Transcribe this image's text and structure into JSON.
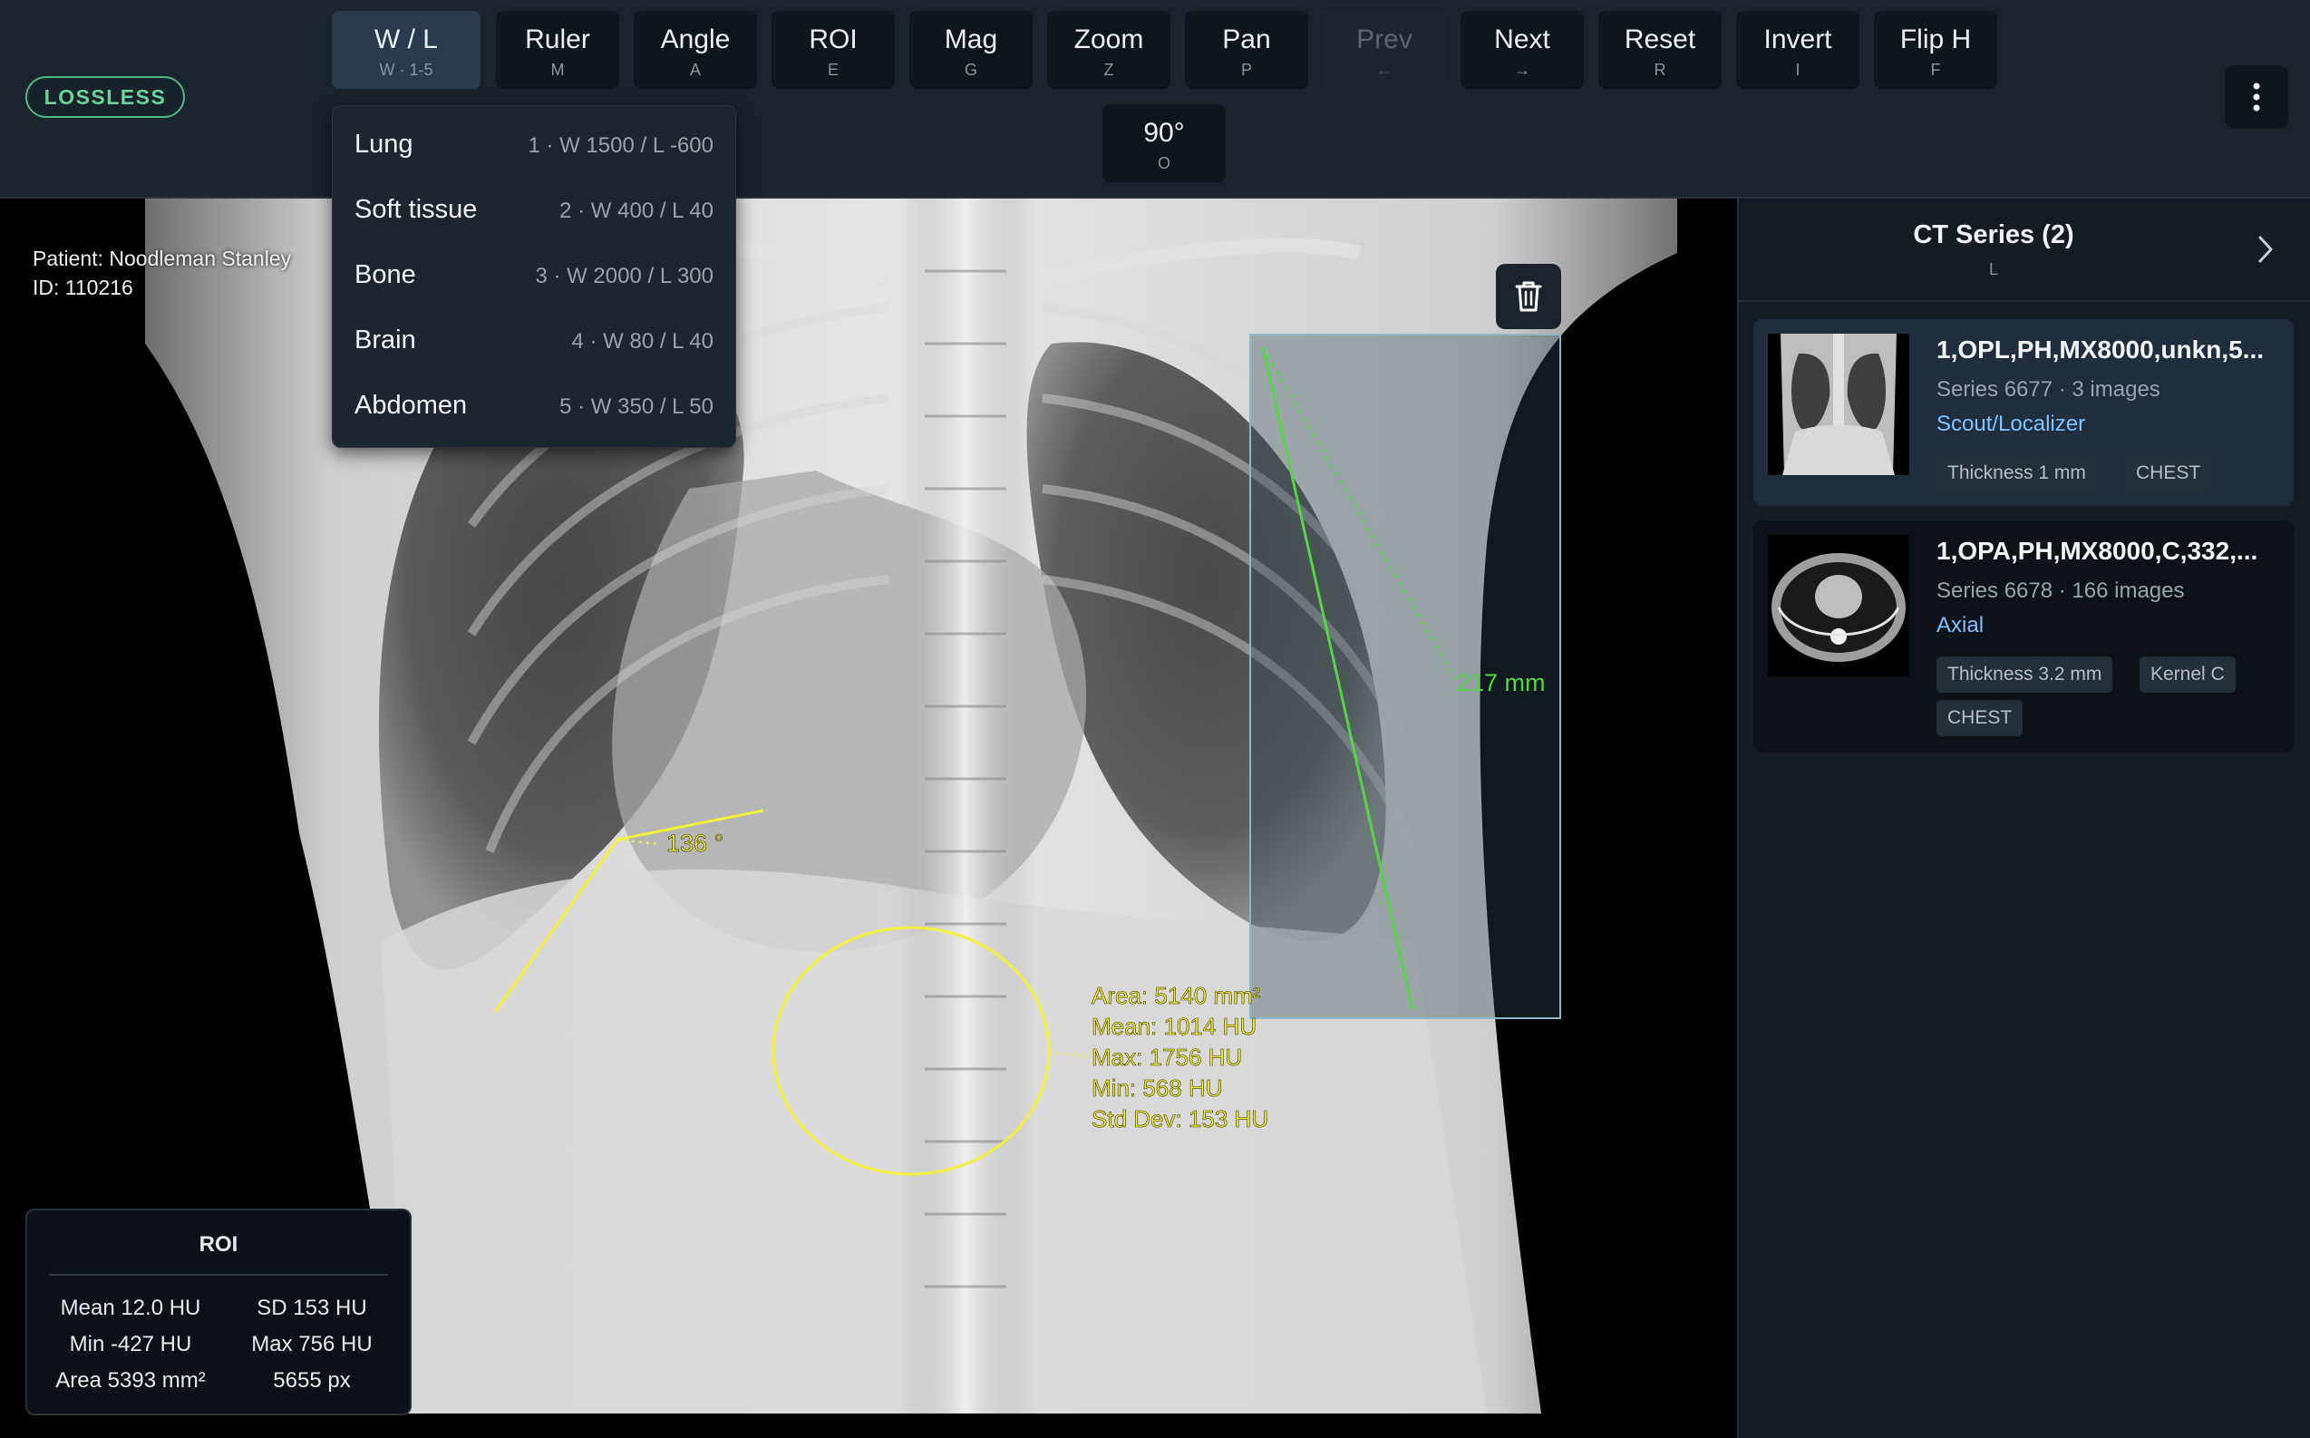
{
  "toolbar": {
    "badge": "LOSSLESS",
    "tools": [
      {
        "label": "W / L",
        "key": "W · 1-5"
      },
      {
        "label": "Ruler",
        "key": "M"
      },
      {
        "label": "Angle",
        "key": "A"
      },
      {
        "label": "ROI",
        "key": "E"
      },
      {
        "label": "Mag",
        "key": "G"
      },
      {
        "label": "Zoom",
        "key": "Z"
      },
      {
        "label": "Pan",
        "key": "P"
      },
      {
        "label": "Prev",
        "key": "←"
      },
      {
        "label": "Next",
        "key": "→"
      },
      {
        "label": "Reset",
        "key": "R"
      },
      {
        "label": "Invert",
        "key": "I"
      },
      {
        "label": "Flip H",
        "key": "F"
      }
    ],
    "rotate": {
      "label": "90°",
      "key": "O"
    },
    "more_icon": "more-vertical-icon"
  },
  "wl_menu": {
    "items": [
      {
        "name": "Lung",
        "preset": "1 · W 1500 / L -600"
      },
      {
        "name": "Soft tissue",
        "preset": "2 · W 400 / L 40"
      },
      {
        "name": "Bone",
        "preset": "3 · W 2000 / L 300"
      },
      {
        "name": "Brain",
        "preset": "4 · W 80 / L 40"
      },
      {
        "name": "Abdomen",
        "preset": "5 · W 350 / L 50"
      }
    ]
  },
  "viewer": {
    "patient_name": "Patient: Noodleman Stanley",
    "patient_id": "ID: 110216",
    "angle_label": "136 °",
    "ruler_label": "217 mm",
    "roi_overlay": {
      "area": "Area: 5140 mm²",
      "mean": "Mean: 1014 HU",
      "max": "Max: 1756 HU",
      "min": "Min: 568 HU",
      "std": "Std Dev: 153 HU"
    },
    "trash_icon": "trash-icon",
    "colors": {
      "ruler": "#55d44a",
      "angle_roi": "#f2f03a"
    }
  },
  "roi_panel": {
    "title": "ROI",
    "mean": "Mean 12.0 HU",
    "sd": "SD 153 HU",
    "min": "Min -427 HU",
    "max": "Max 756 HU",
    "area": "Area 5393 mm²",
    "px": "5655 px"
  },
  "series_panel": {
    "title": "CT Series (2)",
    "key": "L",
    "series": [
      {
        "title": "1,OPL,PH,MX8000,unkn,5...",
        "subtitle": "Series 6677 · 3 images",
        "type": "Scout/Localizer",
        "tags": [
          "Thickness 1 mm",
          "CHEST"
        ]
      },
      {
        "title": "1,OPA,PH,MX8000,C,332,...",
        "subtitle": "Series 6678 · 166 images",
        "type": "Axial",
        "tags": [
          "Thickness 3.2 mm",
          "Kernel C",
          "CHEST"
        ]
      }
    ]
  }
}
